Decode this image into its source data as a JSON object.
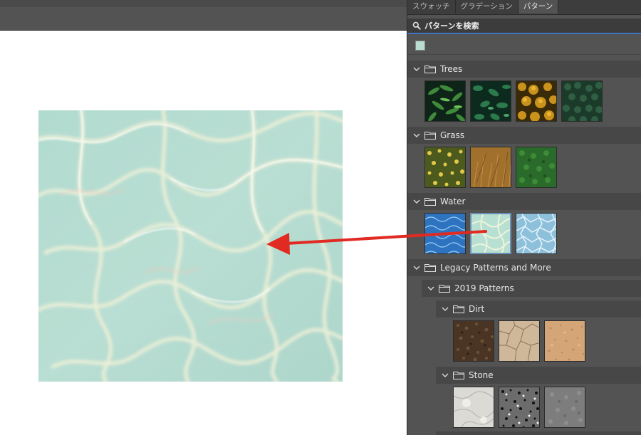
{
  "panel": {
    "tabs": [
      {
        "label": "スウォッチ"
      },
      {
        "label": "グラデーション"
      },
      {
        "label": "パターン"
      }
    ],
    "active_tab": "パターン",
    "search": {
      "value": "パターンを検索"
    },
    "groups": {
      "trees": {
        "label": "Trees",
        "patterns": [
          "fern-dark",
          "leaves-dark",
          "autumn-canopy",
          "pine-forest"
        ]
      },
      "grass": {
        "label": "Grass",
        "patterns": [
          "dry-grass-flowers",
          "brown-grass",
          "green-grass"
        ]
      },
      "water": {
        "label": "Water",
        "patterns": [
          "blue-pool-water",
          "shallow-water",
          "light-water-caustics"
        ],
        "selected": "shallow-water"
      },
      "legacy": {
        "label": "Legacy Patterns and More"
      },
      "patterns2019": {
        "label": "2019 Patterns"
      },
      "dirt": {
        "label": "Dirt",
        "patterns": [
          "dark-soil",
          "cracked-earth",
          "sand"
        ]
      },
      "stone": {
        "label": "Stone",
        "patterns": [
          "marble",
          "granite-speckle",
          "grey-stone"
        ]
      }
    }
  },
  "colors": {
    "panel_bg": "#535353",
    "header_bg": "#474747",
    "accent": "#3d76c4",
    "arrow": "#e02a22",
    "water_base": "#b8ddd2"
  },
  "icons": {
    "search": "search-icon",
    "folder": "folder-icon",
    "chevron": "chevron-down-icon",
    "arrow": "arrow-left-icon"
  }
}
